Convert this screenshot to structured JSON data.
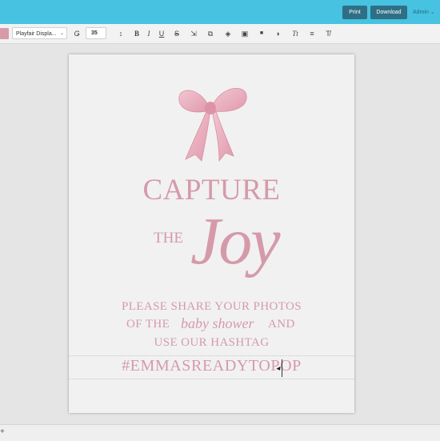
{
  "header": {
    "print_label": "Print",
    "download_label": "Download",
    "user_label": "Admin ⌄",
    "accent_color": "#47c2e1",
    "button_color": "#2f6f85"
  },
  "toolbar": {
    "color_swatch": "#d79aa9",
    "font_name": "Playfair Displa...",
    "font_chevron": "⌄",
    "font_size": "35",
    "icons": [
      "text-effect-icon",
      "letter-spacing-icon",
      "bold-icon",
      "italic-icon",
      "underline-icon",
      "strikethrough-icon",
      "resize-icon",
      "duplicate-icon",
      "layers-icon",
      "arrange-icon",
      "lock-icon",
      "opacity-icon",
      "text-transform-icon",
      "line-spacing-icon",
      "clear-format-icon"
    ],
    "glyphs": {
      "effect": "Ǥ",
      "spacing": "↕",
      "bold": "B",
      "italic": "I",
      "underline": "U",
      "strike": "S",
      "resize": "⇲",
      "duplicate": "⧉",
      "layers": "◈",
      "arrange": "▣",
      "lock": "■",
      "opacity": "◑",
      "transform": "Tt",
      "linespacing": "≡",
      "clear": "T̸"
    }
  },
  "document": {
    "text_color": "#d59aaa",
    "capture": "CAPTURE",
    "the": "THE",
    "joy": "Joy",
    "line1": "PLEASE SHARE YOUR PHOTOS",
    "line2_prefix": "OF THE",
    "line2_script": "baby shower",
    "line2_suffix": "AND",
    "line3": "USE OUR HASHTAG",
    "hashtag": "#EMMASREADYTOPOP"
  },
  "footer": {
    "add_label": "+"
  }
}
